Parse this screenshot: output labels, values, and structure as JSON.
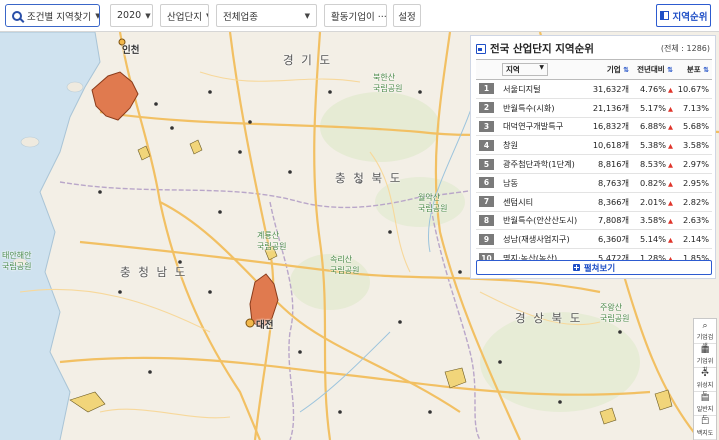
{
  "toolbar": {
    "search_label": "조건별 지역찾기",
    "year_value": "2020",
    "complex_value": "산업단지",
    "industry_value": "전체업종",
    "activity_value": "활동기업이 ···",
    "setting_label": "설정",
    "region_rank_label": "지역순위"
  },
  "map": {
    "labels": {
      "incheon": "인천",
      "gyeonggi": "경 기 도",
      "chungbuk": "충 청 북 도",
      "chungnam": "충 청 남 도",
      "gyeongbuk": "경 상 북 도",
      "daejeon": "대전",
      "songnisan": "속리산\n국립공원",
      "gyeryongsan": "계룡산\n국립공원",
      "woraksan": "월악산\n국립공원",
      "taean": "태안해안\n국립공원",
      "juwangsan": "주왕산\n국립공원",
      "bukhansan": "북한산\n국립공원"
    }
  },
  "panel": {
    "title": "전국 산업단지 지역순위",
    "total": "(전체 : 1286)",
    "columns": {
      "region_select": "지역",
      "companies": "기업",
      "yoy": "전년대비",
      "share": "분포"
    },
    "rows": [
      {
        "rank": "1",
        "name": "서울디지털",
        "companies": "31,632개",
        "yoy": "4.76%",
        "share": "10.67%"
      },
      {
        "rank": "2",
        "name": "반월특수(시화)",
        "companies": "21,136개",
        "yoy": "5.17%",
        "share": "7.13%"
      },
      {
        "rank": "3",
        "name": "대덕연구개발특구",
        "companies": "16,832개",
        "yoy": "6.88%",
        "share": "5.68%"
      },
      {
        "rank": "4",
        "name": "창원",
        "companies": "10,618개",
        "yoy": "5.38%",
        "share": "3.58%"
      },
      {
        "rank": "5",
        "name": "광주첨단과학(1단계)",
        "companies": "8,816개",
        "yoy": "8.53%",
        "share": "2.97%"
      },
      {
        "rank": "6",
        "name": "남동",
        "companies": "8,763개",
        "yoy": "0.82%",
        "share": "2.95%"
      },
      {
        "rank": "7",
        "name": "센텀시티",
        "companies": "8,366개",
        "yoy": "2.01%",
        "share": "2.82%"
      },
      {
        "rank": "8",
        "name": "반월특수(안산산도시)",
        "companies": "7,808개",
        "yoy": "3.58%",
        "share": "2.63%"
      },
      {
        "rank": "9",
        "name": "성남(재생사업지구)",
        "companies": "6,360개",
        "yoy": "5.14%",
        "share": "2.14%"
      },
      {
        "rank": "10",
        "name": "명지·녹산(녹산)",
        "companies": "5,472개",
        "yoy": "1.28%",
        "share": "1.85%"
      }
    ],
    "more_label": "펼쳐보기"
  },
  "tools": [
    {
      "label": "기업검색",
      "icon": "search-icon"
    },
    {
      "label": "기업위치",
      "icon": "building-icon"
    },
    {
      "label": "위성지도",
      "icon": "satellite-icon"
    },
    {
      "label": "일반지도",
      "icon": "map-icon"
    },
    {
      "label": "백지도",
      "icon": "blank-map-icon"
    }
  ],
  "colors": {
    "accent": "#1f4fc6",
    "highlight_region": "#e07a4f",
    "up_arrow": "#e0352b"
  }
}
